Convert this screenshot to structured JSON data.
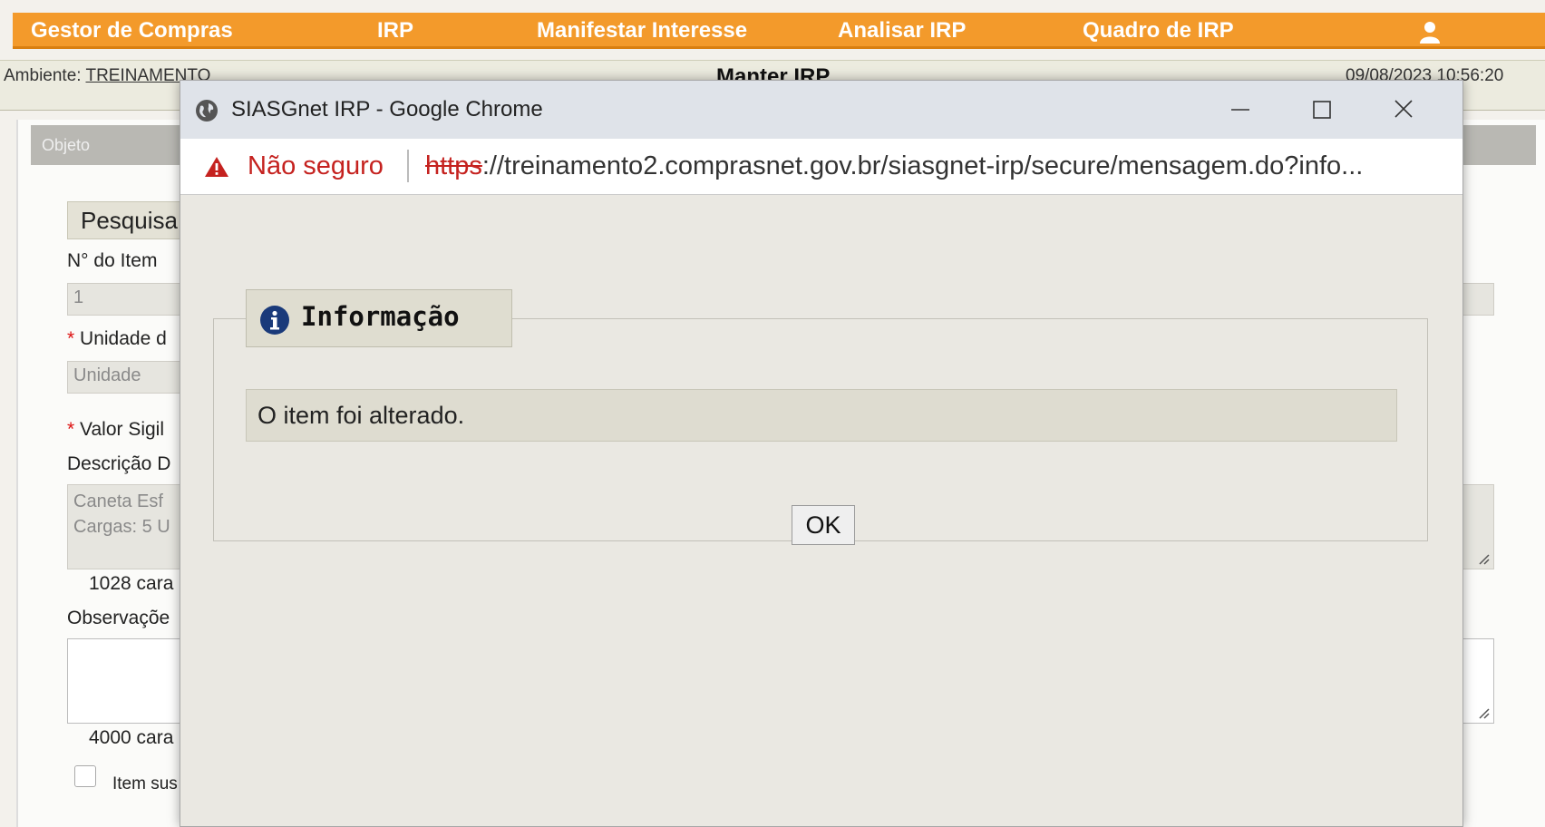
{
  "nav": {
    "items": [
      "Gestor de Compras",
      "IRP",
      "Manifestar Interesse",
      "Analisar IRP",
      "Quadro de IRP"
    ],
    "user_icon": "user-icon",
    "color": "#f39a2b"
  },
  "env": {
    "label": "Ambiente:",
    "value": "TREINAMENTO",
    "page_title": "Manter IRP",
    "datetime": "09/08/2023 10:56:20"
  },
  "form": {
    "panel_header": "Objeto",
    "section_tab": "Pesquisa",
    "item_number_label": "N° do Item",
    "item_number_value": "1",
    "unit_label": "Unidade d",
    "unit_value": "Unidade",
    "valor_label": "Valor Sigil",
    "descricao_label": "Descrição D",
    "descricao_line1": "Caneta Esf",
    "descricao_line2": "Cargas: 5 U",
    "descricao_count": "1028 cara",
    "observacoes_label": "Observaçõe",
    "observacoes_count": "4000 cara",
    "checkbox_label": "Item sus"
  },
  "popup": {
    "window_title": "SIASGnet IRP - Google Chrome",
    "not_secure": "Não seguro",
    "url_scheme": "https",
    "url_rest": "://treinamento2.comprasnet.gov.br/siasgnet-irp/secure/mensagem.do?info...",
    "legend": "Informação",
    "message": "O item foi alterado.",
    "ok_label": "OK"
  }
}
